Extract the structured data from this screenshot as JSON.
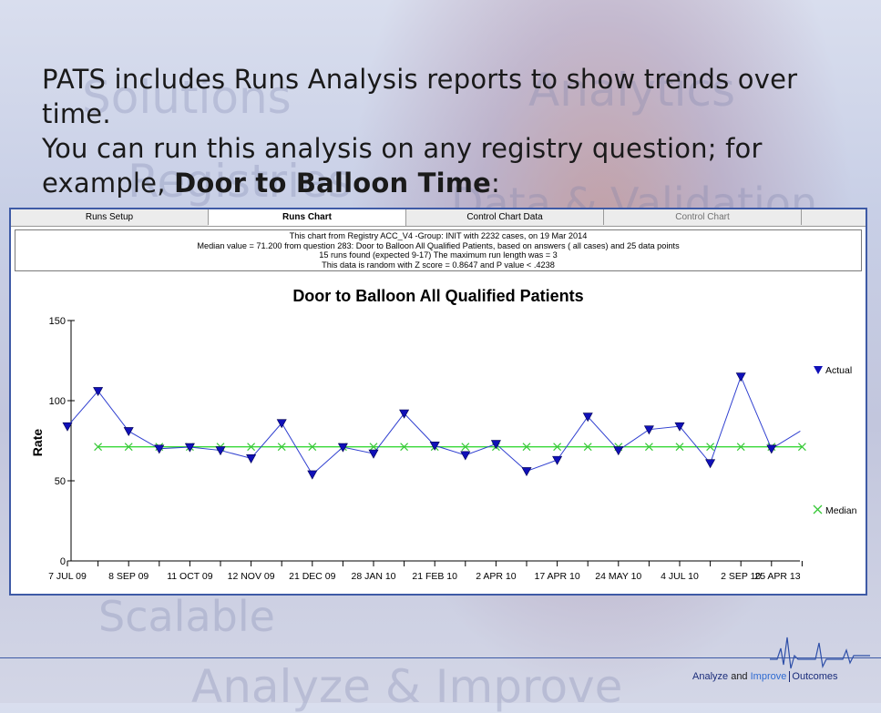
{
  "headline": {
    "line1": "PATS includes Runs Analysis reports to show trends over time.",
    "line2": "You can run this analysis on any registry question; for",
    "line3_prefix": "example, ",
    "line3_bold": "Door to Balloon Time",
    "line3_suffix": ":"
  },
  "background_words": [
    "Solutions",
    "Analytics",
    "Registries",
    "Data & Validation",
    "Scalable",
    "Analyze & Improve"
  ],
  "tabs": [
    {
      "label": "Runs Setup",
      "state": "normal"
    },
    {
      "label": "Runs Chart",
      "state": "active"
    },
    {
      "label": "Control Chart Data",
      "state": "normal"
    },
    {
      "label": "Control Chart",
      "state": "disabled"
    }
  ],
  "info_lines": [
    "This chart from Registry ACC_V4 -Group: INIT with 2232 cases, on 19 Mar 2014",
    "Median value = 71.200 from question 283: Door to Balloon All Qualified Patients, based on answers ( all cases) and 25 data points",
    "15 runs found  (expected 9-17)        The maximum run length was =  3",
    "This data is random with Z score = 0.8647 and P value <  .4238"
  ],
  "footer": {
    "analyze": "Analyze",
    "and": " and ",
    "improve": "Improve",
    "outcomes": "Outcomes"
  },
  "colors": {
    "actual_line": "#2f3fd0",
    "actual_marker": "#1010b8",
    "median_line": "#38d838",
    "median_marker": "#38c838",
    "panel_border": "#3e5aa6"
  },
  "chart_data": {
    "type": "line",
    "title": "Door to Balloon All Qualified Patients",
    "xlabel": "",
    "ylabel": "Rate",
    "ylim": [
      0,
      150
    ],
    "yticks": [
      0,
      50,
      100,
      150
    ],
    "x_tick_labels": [
      "7 JUL 09",
      "8 SEP 09",
      "11 OCT 09",
      "12 NOV 09",
      "21 DEC 09",
      "28 JAN 10",
      "21 FEB 10",
      "2 APR 10",
      "17 APR 10",
      "24 MAY 10",
      "4 JUL 10",
      "2 SEP 10",
      "25 APR 13"
    ],
    "grid": false,
    "legend_placement": "right",
    "series": [
      {
        "name": "Actual",
        "marker": "triangle-down",
        "values": [
          84,
          106,
          81,
          70,
          71,
          69,
          64,
          86,
          54,
          71,
          67,
          92,
          72,
          66,
          73,
          56,
          63,
          90,
          69,
          82,
          84,
          61,
          115,
          70
        ],
        "trailing_value": 81
      },
      {
        "name": "Median",
        "marker": "x",
        "values": [
          71.2,
          71.2,
          71.2,
          71.2,
          71.2,
          71.2,
          71.2,
          71.2,
          71.2,
          71.2,
          71.2,
          71.2,
          71.2,
          71.2,
          71.2,
          71.2,
          71.2,
          71.2,
          71.2,
          71.2,
          71.2,
          71.2,
          71.2,
          71.2
        ]
      }
    ]
  }
}
